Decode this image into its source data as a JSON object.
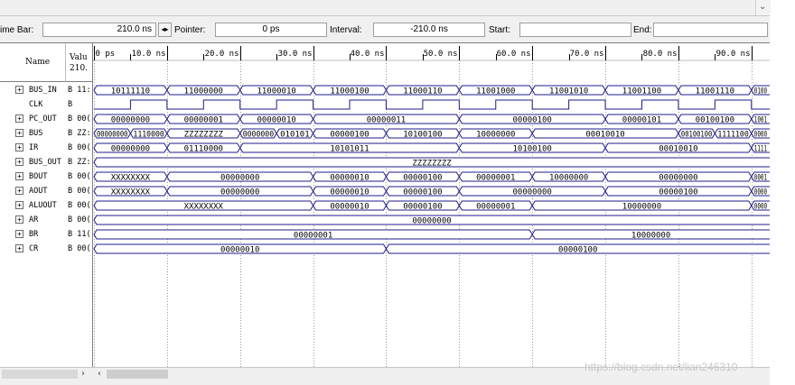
{
  "toolbar": {
    "time_bar_label": "ime Bar:",
    "time_bar_value": "210.0 ns",
    "pointer_label": "Pointer:",
    "pointer_value": "0 ps",
    "interval_label": "Interval:",
    "interval_value": "-210.0 ns",
    "start_label": "Start:",
    "start_value": "",
    "end_label": "End:",
    "end_value": ""
  },
  "headers": {
    "name": "Name",
    "value_line1": "Valu",
    "value_line2": "210."
  },
  "time_axis": {
    "labels": [
      "0 ps",
      "10.0 ns",
      "20.0 ns",
      "30.0 ns",
      "40.0 ns",
      "50.0 ns",
      "60.0 ns",
      "70.0 ns",
      "80.0 ns",
      "90.0 ns"
    ],
    "start_ns": 0,
    "end_ns": 92.5
  },
  "signals": [
    {
      "name": "BUS_IN",
      "value": "B 11:",
      "group": true,
      "type": "bus",
      "segments": [
        [
          0,
          "10111110"
        ],
        [
          10,
          "11000000"
        ],
        [
          20,
          "11000010"
        ],
        [
          30,
          "11000100"
        ],
        [
          40,
          "11000110"
        ],
        [
          50,
          "11001000"
        ],
        [
          60,
          "11001010"
        ],
        [
          70,
          "11001100"
        ],
        [
          80,
          "11001110"
        ],
        [
          90,
          "0100"
        ]
      ]
    },
    {
      "name": "CLK",
      "value": "B",
      "group": false,
      "type": "clock",
      "period_ns": 10,
      "high_first": false
    },
    {
      "name": "PC_OUT",
      "value": "B 00(",
      "group": true,
      "type": "bus",
      "segments": [
        [
          0,
          "00000000"
        ],
        [
          10,
          "00000001"
        ],
        [
          20,
          "00000010"
        ],
        [
          30,
          "00000011"
        ],
        [
          50,
          "00000100"
        ],
        [
          70,
          "00000101"
        ],
        [
          80,
          "00100100"
        ],
        [
          90,
          "1001"
        ]
      ]
    },
    {
      "name": "BUS",
      "value": "B ZZ:",
      "group": true,
      "type": "bus",
      "segments": [
        [
          0,
          "00000000"
        ],
        [
          5,
          "1110000"
        ],
        [
          10,
          "ZZZZZZZZ"
        ],
        [
          20,
          "0000000"
        ],
        [
          25,
          "010101"
        ],
        [
          30,
          "00000100"
        ],
        [
          40,
          "10100100"
        ],
        [
          50,
          "10000000"
        ],
        [
          60,
          "00010010"
        ],
        [
          80,
          "00100100"
        ],
        [
          85,
          "1111100"
        ],
        [
          90,
          "0000"
        ]
      ]
    },
    {
      "name": "IR",
      "value": "B 00(",
      "group": true,
      "type": "bus",
      "segments": [
        [
          0,
          "00000000"
        ],
        [
          10,
          "01110000"
        ],
        [
          20,
          "10101011"
        ],
        [
          50,
          "10100100"
        ],
        [
          70,
          "00010010"
        ],
        [
          90,
          "1111"
        ]
      ]
    },
    {
      "name": "BUS_OUT",
      "value": "B ZZ:",
      "group": true,
      "type": "bus",
      "segments": [
        [
          0,
          "ZZZZZZZZ"
        ]
      ]
    },
    {
      "name": "BOUT",
      "value": "B 00(",
      "group": true,
      "type": "bus",
      "segments": [
        [
          0,
          "XXXXXXXX"
        ],
        [
          10,
          "00000000"
        ],
        [
          30,
          "00000010"
        ],
        [
          40,
          "00000100"
        ],
        [
          50,
          "00000001"
        ],
        [
          60,
          "10000000"
        ],
        [
          70,
          "00000000"
        ],
        [
          90,
          "0001"
        ]
      ]
    },
    {
      "name": "AOUT",
      "value": "B 00(",
      "group": true,
      "type": "bus",
      "segments": [
        [
          0,
          "XXXXXXXX"
        ],
        [
          10,
          "00000000"
        ],
        [
          30,
          "00000010"
        ],
        [
          40,
          "00000100"
        ],
        [
          50,
          "00000000"
        ],
        [
          70,
          "00000100"
        ],
        [
          90,
          "0000"
        ]
      ]
    },
    {
      "name": "ALUOUT",
      "value": "B 00(",
      "group": true,
      "type": "bus",
      "segments": [
        [
          0,
          "XXXXXXXX"
        ],
        [
          30,
          "00000010"
        ],
        [
          40,
          "00000100"
        ],
        [
          50,
          "00000001"
        ],
        [
          60,
          "10000000"
        ],
        [
          90,
          "0000"
        ]
      ]
    },
    {
      "name": "AR",
      "value": "B 00(",
      "group": true,
      "type": "bus",
      "segments": [
        [
          0,
          "00000000"
        ]
      ]
    },
    {
      "name": "BR",
      "value": "B 11(",
      "group": true,
      "type": "bus",
      "segments": [
        [
          0,
          "00000001"
        ],
        [
          60,
          "10000000"
        ]
      ]
    },
    {
      "name": "CR",
      "value": "B 00(",
      "group": true,
      "type": "bus",
      "segments": [
        [
          0,
          "00000010"
        ],
        [
          40,
          "00000100"
        ]
      ]
    }
  ],
  "watermark": "https://blog.csdn.net/lian246310",
  "colors": {
    "wave": "#1c1c8c",
    "grid": "#9a9a9a",
    "text": "#000000"
  }
}
